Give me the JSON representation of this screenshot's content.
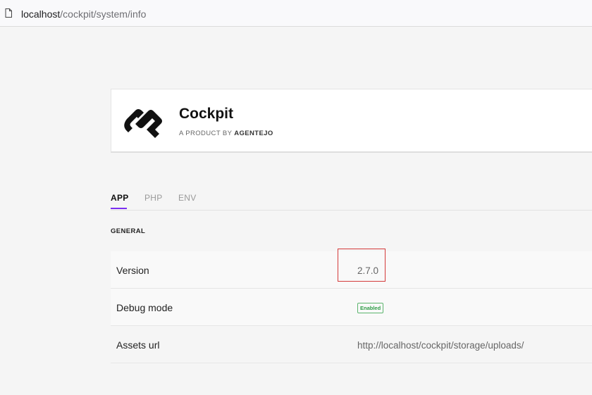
{
  "browser": {
    "url_host": "localhost",
    "url_path": "/cockpit/system/info"
  },
  "brand": {
    "title": "Cockpit",
    "subtitle_prefix": "A PRODUCT BY",
    "subtitle_company": "AGENTEJO",
    "logo_color": "#111111"
  },
  "tabs": [
    {
      "label": "APP",
      "active": true
    },
    {
      "label": "PHP",
      "active": false
    },
    {
      "label": "ENV",
      "active": false
    }
  ],
  "accent_color": "#7b2ff2",
  "section": {
    "label": "GENERAL"
  },
  "rows": [
    {
      "label": "Version",
      "value": "2.7.0"
    },
    {
      "label": "Debug mode",
      "badge": "Enabled"
    },
    {
      "label": "Assets url",
      "value": "http://localhost/cockpit/storage/uploads/"
    }
  ],
  "annotation": {
    "highlight_color": "#d43a3a"
  }
}
